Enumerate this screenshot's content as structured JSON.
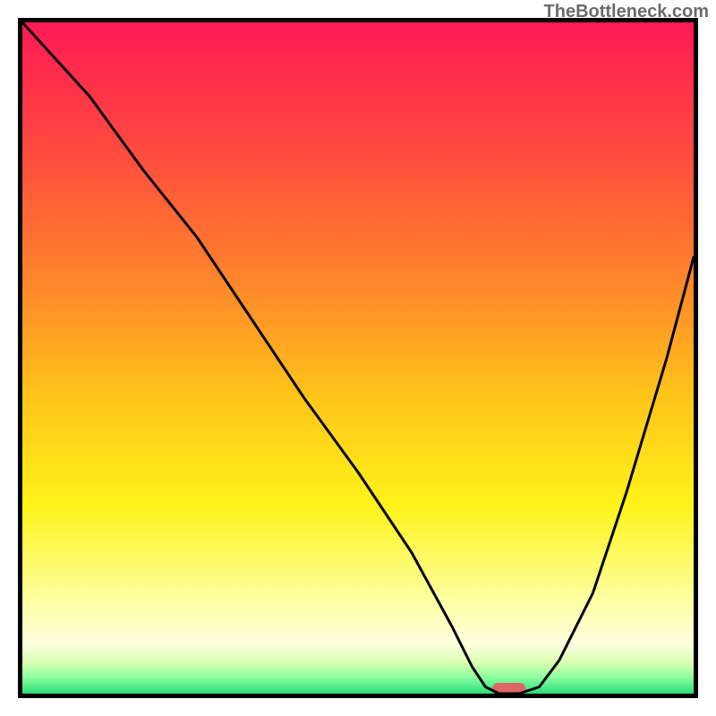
{
  "watermark": "TheBottleneck.com",
  "chart_data": {
    "type": "line",
    "title": "",
    "xlabel": "",
    "ylabel": "",
    "xlim": [
      0,
      100
    ],
    "ylim": [
      0,
      100
    ],
    "axes_visible": false,
    "ticks_visible": false,
    "grid": false,
    "legend": false,
    "background_gradient": {
      "type": "vertical",
      "stops": [
        {
          "pos": 0.0,
          "color": "#ff1955"
        },
        {
          "pos": 0.2,
          "color": "#ff4d3e"
        },
        {
          "pos": 0.4,
          "color": "#ff8a2a"
        },
        {
          "pos": 0.55,
          "color": "#ffc21a"
        },
        {
          "pos": 0.72,
          "color": "#fff31a"
        },
        {
          "pos": 0.86,
          "color": "#fdffa0"
        },
        {
          "pos": 0.925,
          "color": "#feffe0"
        },
        {
          "pos": 0.955,
          "color": "#d6ffb0"
        },
        {
          "pos": 0.975,
          "color": "#8fff9f"
        },
        {
          "pos": 1.0,
          "color": "#29e07a"
        }
      ]
    },
    "series": [
      {
        "name": "bottleneck-curve",
        "color": "#000000",
        "x": [
          0,
          10,
          18,
          26,
          34,
          42,
          50,
          58,
          64,
          67,
          69,
          71,
          74,
          77,
          80,
          85,
          90,
          96,
          100
        ],
        "y": [
          100,
          89,
          78,
          68,
          56,
          44,
          33,
          21,
          10,
          4,
          1,
          0,
          0,
          1,
          5,
          15,
          30,
          50,
          65
        ]
      }
    ],
    "marker": {
      "name": "optimal-point",
      "x": 72.5,
      "y": 0,
      "width_x": 5,
      "color": "#e06666",
      "shape": "rounded-bar"
    },
    "frame_color": "#000000",
    "frame_thickness_px": 5
  }
}
